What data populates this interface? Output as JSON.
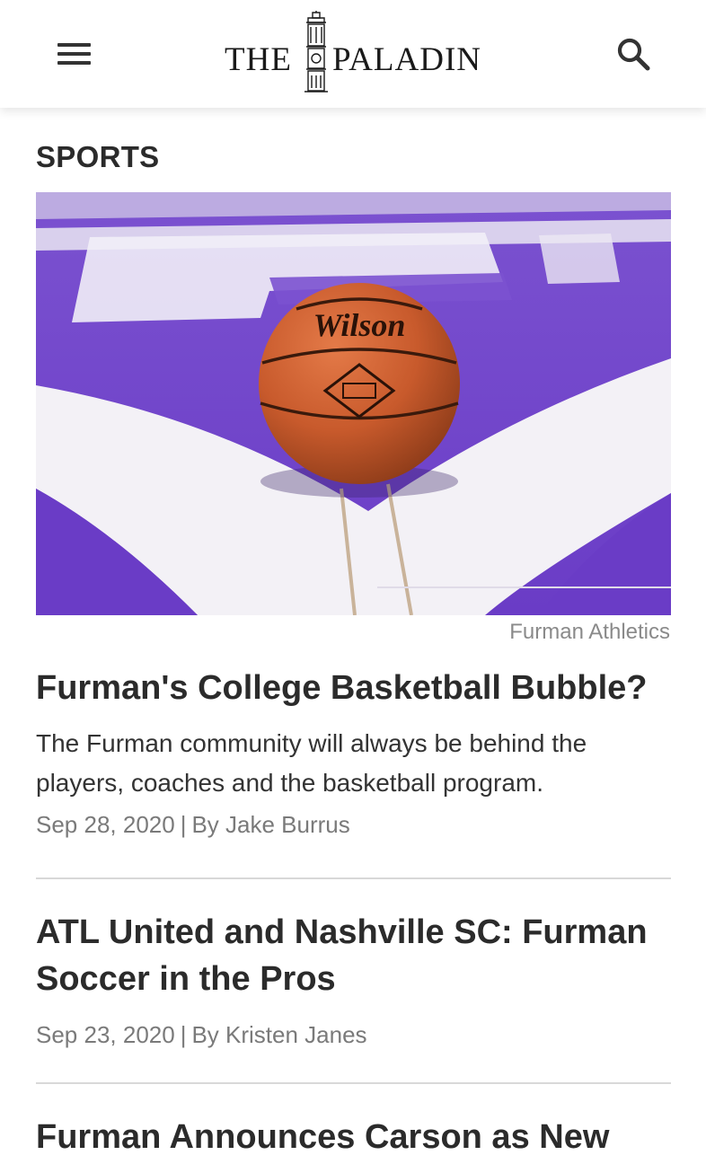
{
  "header": {
    "logo_left": "THE",
    "logo_right": "PALADIN",
    "menu_icon": "hamburger-menu-icon",
    "search_icon": "search-icon"
  },
  "section": {
    "title": "SPORTS"
  },
  "hero": {
    "caption": "Furman Athletics",
    "ball_brand": "Wilson",
    "colors": {
      "court_purple": "#6b3fc4",
      "court_white": "#f3f1f6",
      "ball_orange": "#c85a2c"
    }
  },
  "articles": [
    {
      "title": "Furman's College Basketball Bubble?",
      "description": "The Furman community will always be behind the players, coaches and the basketball program.",
      "date": "Sep 28, 2020",
      "separator": "|",
      "byline": "By Jake Burrus"
    },
    {
      "title": "ATL United and Nashville SC: Furman Soccer in the Pros",
      "date": "Sep 23, 2020",
      "separator": "|",
      "byline": "By Kristen Janes"
    },
    {
      "title": "Furman Announces Carson as New"
    }
  ]
}
